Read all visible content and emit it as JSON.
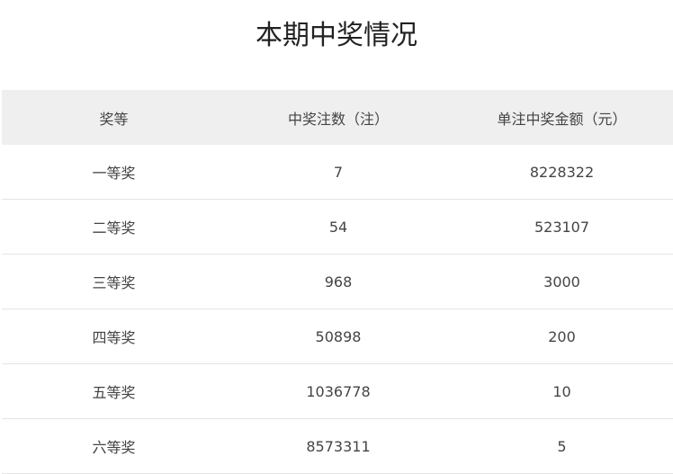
{
  "page": {
    "title": "本期中奖情况"
  },
  "table": {
    "headers": [
      "奖等",
      "中奖注数（注）",
      "单注中奖金额（元）"
    ],
    "rows": [
      [
        "一等奖",
        "7",
        "8228322"
      ],
      [
        "二等奖",
        "54",
        "523107"
      ],
      [
        "三等奖",
        "968",
        "3000"
      ],
      [
        "四等奖",
        "50898",
        "200"
      ],
      [
        "五等奖",
        "1036778",
        "10"
      ],
      [
        "六等奖",
        "8573311",
        "5"
      ]
    ]
  }
}
